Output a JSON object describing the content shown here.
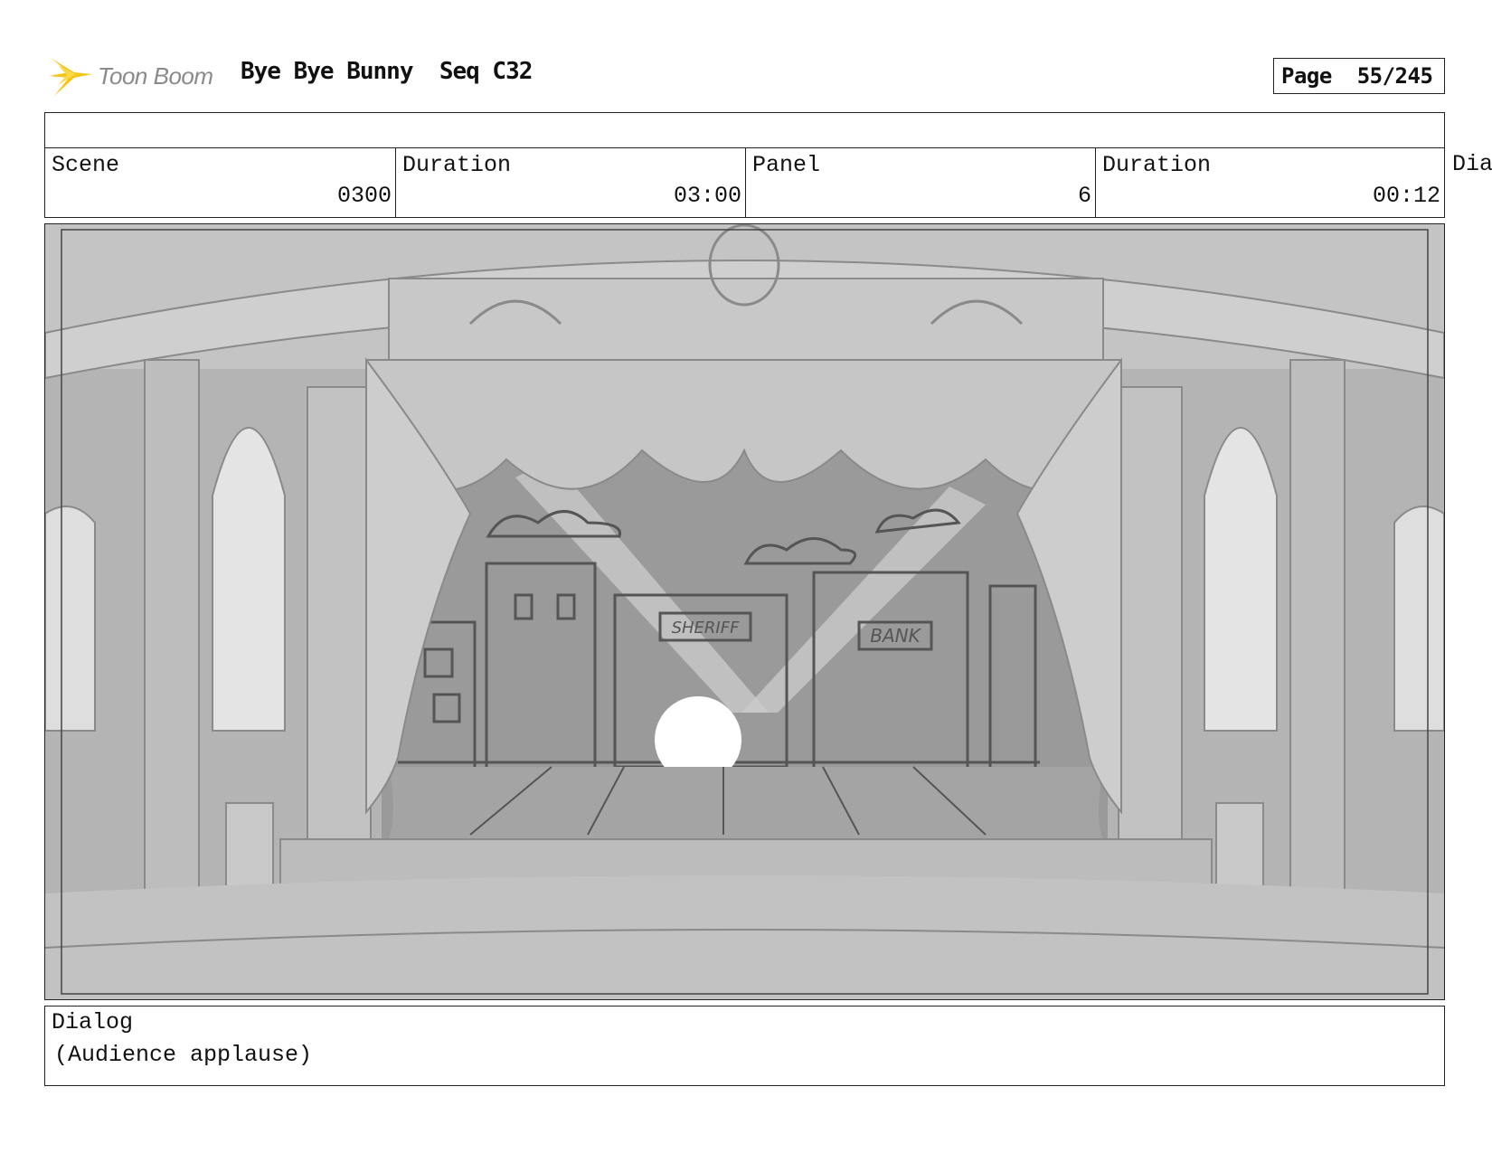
{
  "header": {
    "logo_text": "Toon Boom",
    "project_title": "Bye Bye Bunny",
    "sequence": "Seq C32",
    "page_label": "Page",
    "page_value": "55/245"
  },
  "info": {
    "scene_label": "Scene",
    "scene_value": "0300",
    "scene_duration_label": "Duration",
    "scene_duration_value": "03:00",
    "panel_label": "Panel",
    "panel_value": "6",
    "panel_duration_label": "Duration",
    "panel_duration_value": "00:12",
    "overflow_label": "Dia"
  },
  "panel_image": {
    "sign_sheriff": "SHERIFF",
    "sign_bank": "BANK"
  },
  "dialog": {
    "label": "Dialog",
    "text": "(Audience applause)"
  },
  "colors": {
    "logo_accent": "#f5c518",
    "sketch_mid": "#9e9e9e",
    "sketch_light": "#d6d6d6",
    "sketch_line": "#555555"
  }
}
